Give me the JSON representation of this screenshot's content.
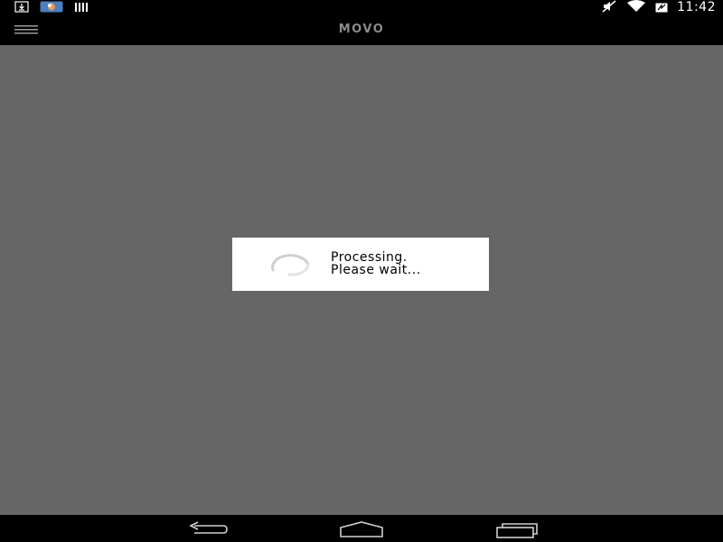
{
  "status_bar": {
    "time": "11:42",
    "left_icons": [
      "download-icon",
      "app-notification-icon",
      "storage-icon"
    ],
    "right_icons": [
      "muted-icon",
      "wifi-icon",
      "battery-icon"
    ]
  },
  "app_bar": {
    "title": "MOVO",
    "menu_icon": "hamburger-menu-icon"
  },
  "dialog": {
    "line1": "Processing.",
    "line2": "Please wait..."
  },
  "nav_bar": {
    "buttons": [
      "back-icon",
      "home-icon",
      "recents-icon"
    ]
  },
  "colors": {
    "overlay": "#666666",
    "bars": "#000000",
    "dialog_bg": "#ffffff",
    "title": "#8a8a8a"
  }
}
